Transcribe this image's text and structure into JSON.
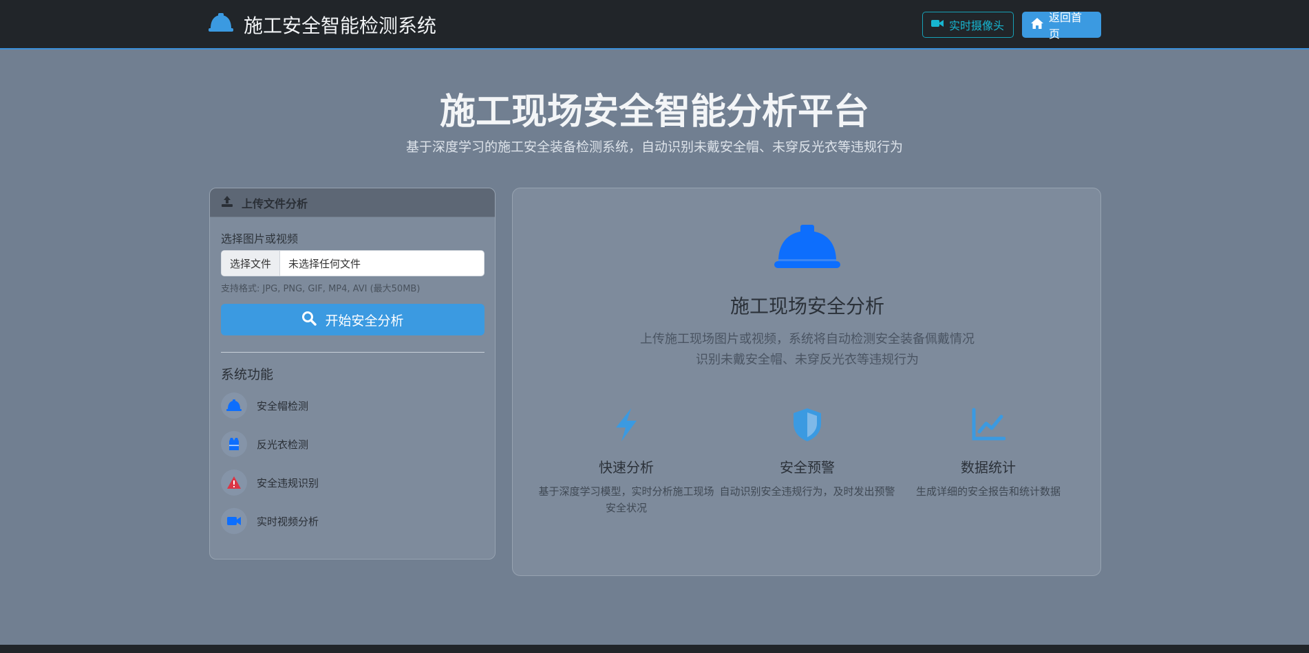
{
  "navbar": {
    "brand_title": "施工安全智能检测系统",
    "camera_button": "实时摄像头",
    "home_button": "返回首页"
  },
  "hero": {
    "title": "施工现场安全智能分析平台",
    "subtitle": "基于深度学习的施工安全装备检测系统，自动识别未戴安全帽、未穿反光衣等违规行为"
  },
  "upload": {
    "header": "上传文件分析",
    "choose_label": "选择图片或视频",
    "file_button": "选择文件",
    "file_status": "未选择任何文件",
    "hint": "支持格式: JPG, PNG, GIF, MP4, AVI (最大50MB)",
    "analyze_button": "开始安全分析",
    "features_title": "系统功能",
    "features": [
      {
        "label": "安全帽检测",
        "icon": "helmet-icon"
      },
      {
        "label": "反光衣检测",
        "icon": "vest-icon"
      },
      {
        "label": "安全违规识别",
        "icon": "warning-icon"
      },
      {
        "label": "实时视频分析",
        "icon": "video-icon"
      }
    ]
  },
  "intro": {
    "title": "施工现场安全分析",
    "desc_line1": "上传施工现场图片或视频，系统将自动检测安全装备佩戴情况",
    "desc_line2": "识别未戴安全帽、未穿反光衣等违规行为",
    "columns": [
      {
        "title": "快速分析",
        "text": "基于深度学习模型，实时分析施工现场安全状况",
        "icon": "bolt-icon"
      },
      {
        "title": "安全预警",
        "text": "自动识别安全违规行为，及时发出预警",
        "icon": "shield-icon"
      },
      {
        "title": "数据统计",
        "text": "生成详细的安全报告和统计数据",
        "icon": "chart-line-icon"
      }
    ]
  },
  "colors": {
    "navbar_bg": "#212529",
    "accent_blue": "#3b9ae1",
    "helmet_blue": "#0d6efd",
    "warning_red": "#dc3545",
    "info_cyan": "#17a2b8"
  }
}
